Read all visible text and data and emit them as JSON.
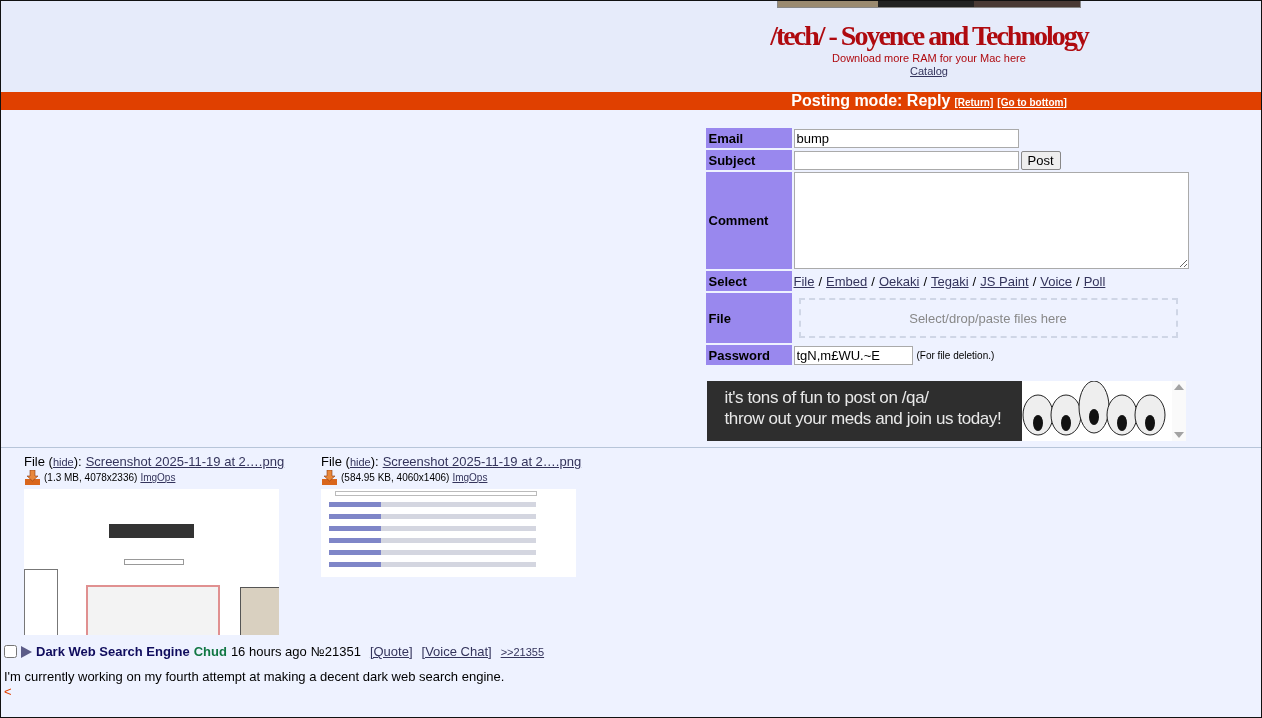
{
  "header": {
    "title": "/tech/ - Soyence and Technology",
    "subtitle": "Download more RAM for your Mac here",
    "catalog_link": "Catalog"
  },
  "posting_bar": {
    "label": "Posting mode: Reply",
    "links": [
      "[Return]",
      "[Go to bottom]"
    ]
  },
  "form": {
    "rows": [
      {
        "kind": "input",
        "label": "Email",
        "value": "bump"
      },
      {
        "kind": "input_button",
        "label": "Subject",
        "button": "Post"
      },
      {
        "kind": "textarea",
        "label": "Comment"
      },
      {
        "kind": "links",
        "label": "Select",
        "links": [
          "File",
          "Embed",
          "Oekaki",
          "Tegaki",
          "JS Paint",
          "Voice",
          "Poll"
        ],
        "separator": "/"
      },
      {
        "kind": "dropzone",
        "label": "File",
        "placeholder": "Select/drop/paste files here"
      },
      {
        "kind": "password",
        "label": "Password",
        "value": "tgN,m£WU.~E",
        "note": "(For file deletion.)"
      }
    ]
  },
  "ad_banner": {
    "lines": [
      "it's tons of fun to post on /qa/",
      "throw out your meds and join us today!"
    ]
  },
  "files": [
    {
      "label": "File (",
      "hide": "hide",
      "after": "):",
      "name": "Screenshot 2025-11-19 at 2….png",
      "meta": "(1.3 MB, 4078x2336)",
      "imgops": "ImgOps",
      "kind": "tall"
    },
    {
      "label": "File (",
      "hide": "hide",
      "after": "):",
      "name": "Screenshot 2025-11-19 at 2….png",
      "meta": "(584.95 KB, 4060x1406)",
      "imgops": "ImgOps",
      "kind": "wide"
    }
  ],
  "post": {
    "checked": false,
    "subject": "Dark Web Search Engine",
    "name": "Chud",
    "time": "16 hours ago",
    "number": "№21351",
    "quote": "[Quote]",
    "voice_chat": "[Voice Chat]",
    "reply_link": ">>21355",
    "body": "I'm currently working on my fourth attempt at making a decent dark web search engine.",
    "quote_mark": "<"
  }
}
